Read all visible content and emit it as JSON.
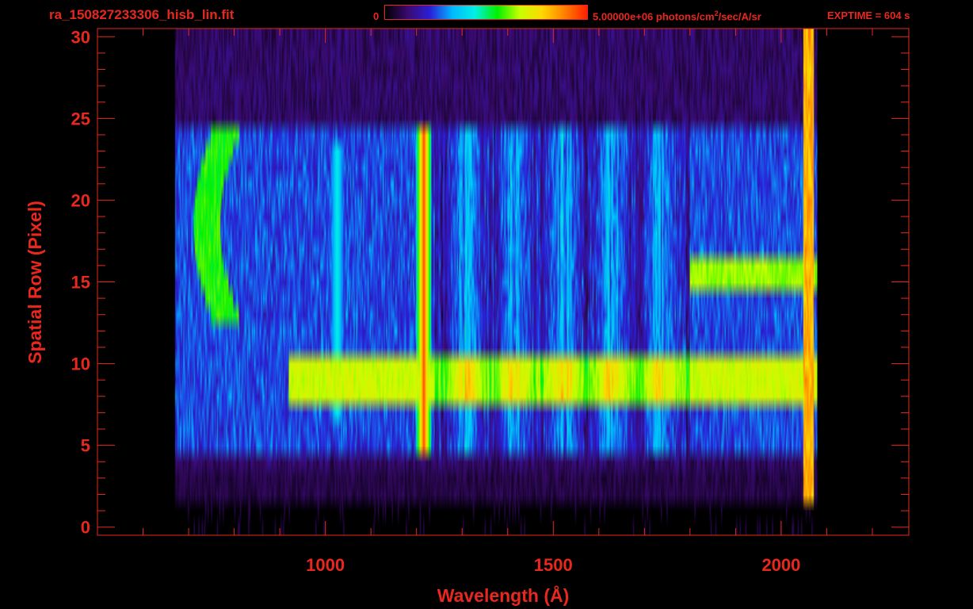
{
  "header": {
    "filename": "ra_150827233306_hisb_lin.fit",
    "colorbar_min": "0",
    "colorbar_max": "5.00000e+06 photons/cm",
    "colorbar_max_sup": "2",
    "colorbar_max_tail": "/sec/A/sr",
    "exptime": "EXPTIME = 604 s"
  },
  "colors": {
    "axis": "#e8281e",
    "background": "#000000",
    "colormap": [
      "#000000",
      "#3a0a6e",
      "#2a1fd8",
      "#00b8ff",
      "#00f0e6",
      "#00f000",
      "#c8ff00",
      "#ffd800",
      "#ff8000",
      "#ff2000"
    ]
  },
  "chart_data": {
    "type": "heatmap",
    "title": "",
    "xlabel": "Wavelength (Å)",
    "ylabel": "Spatial Row (Pixel)",
    "xlim": [
      500,
      2280
    ],
    "ylim": [
      -0.5,
      30.5
    ],
    "x_ticks": [
      1000,
      1500,
      2000
    ],
    "x_tick_labels": [
      "1000",
      "1500",
      "2000"
    ],
    "y_ticks": [
      0,
      5,
      10,
      15,
      20,
      25,
      30
    ],
    "y_tick_labels": [
      "0",
      "5",
      "10",
      "15",
      "20",
      "25",
      "30"
    ],
    "colorbar_range": [
      0,
      5000000
    ],
    "colorbar_unit": "photons/cm^2/sec/A/sr",
    "detector_extent_wavelength": [
      670,
      2080
    ],
    "illuminated_rows": [
      5,
      24
    ],
    "features": [
      {
        "label": "arc",
        "wavelength_range": [
          740,
          870
        ],
        "rows": [
          13,
          24
        ],
        "peak_norm": 0.62
      },
      {
        "label": "band",
        "wavelength_range": [
          920,
          2080
        ],
        "rows": [
          8,
          10
        ],
        "peak_norm": 0.72
      },
      {
        "label": "line",
        "wavelength": 1216,
        "rows": [
          5,
          24
        ],
        "peak_norm": 0.95
      },
      {
        "label": "line",
        "wavelength": 1026,
        "rows": [
          7,
          23
        ],
        "peak_norm": 0.45
      },
      {
        "label": "band",
        "wavelength_range": [
          1800,
          2080
        ],
        "rows": [
          15,
          16
        ],
        "peak_norm": 0.68
      },
      {
        "label": "edge",
        "wavelength": 2060,
        "rows": [
          2,
          30
        ],
        "peak_norm": 0.9
      }
    ]
  }
}
